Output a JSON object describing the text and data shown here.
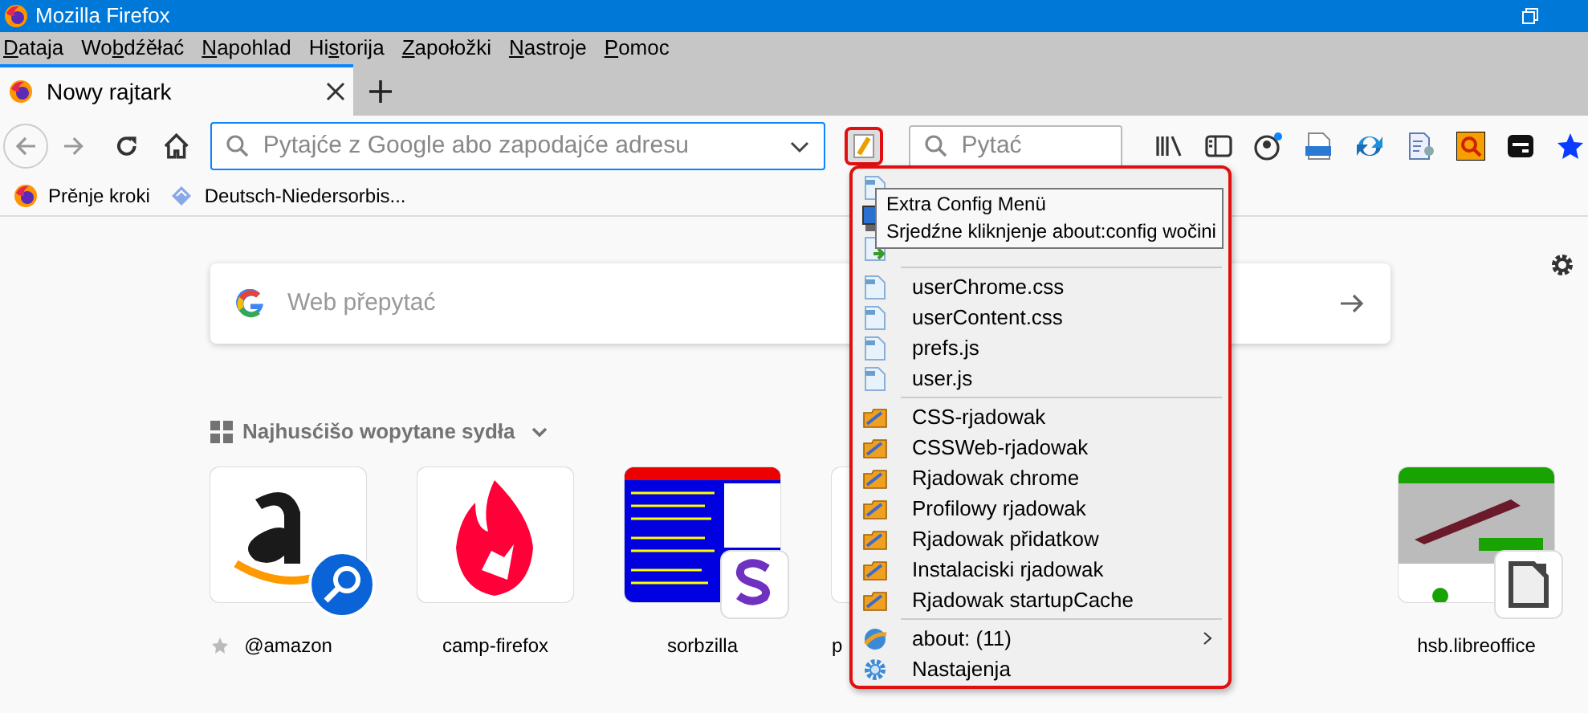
{
  "window": {
    "title": "Mozilla Firefox"
  },
  "menu_bar": [
    {
      "accel": "D",
      "after": "ataja"
    },
    {
      "before": "Wo",
      "accel": "b",
      "after": "dźěłać"
    },
    {
      "accel": "N",
      "after": "apohlad"
    },
    {
      "before": "Hi",
      "accel": "s",
      "after": "torija"
    },
    {
      "accel": "Z",
      "after": "apołožki"
    },
    {
      "accel": "N",
      "after": "astroje"
    },
    {
      "accel": "P",
      "after": "omoc"
    }
  ],
  "tabs": [
    {
      "label": "Nowy rajtark",
      "selected": true
    }
  ],
  "address_bar": {
    "placeholder": "Pytajće z Google abo zapodajće adresu"
  },
  "search_field": {
    "placeholder": "Pytać"
  },
  "bookmarks": [
    {
      "label": "Prěnje kroki",
      "kind": "firefox"
    },
    {
      "label": "Deutsch-Niedersorbis...",
      "kind": "dict"
    }
  ],
  "content": {
    "search": {
      "placeholder": "Web přepytać"
    },
    "top_sites_heading": "Najhusćišo wopytane sydła",
    "top_sites": [
      {
        "label": "@amazon",
        "kind": "amazon",
        "pinned": true
      },
      {
        "label": "camp-firefox",
        "kind": "flame",
        "pinned": false
      },
      {
        "label": "sorbzilla",
        "kind": "sorbzilla",
        "pinned": false
      },
      {
        "label": "p",
        "kind": "blank",
        "pinned": false
      },
      {
        "label": "hsb.libreoffice",
        "kind": "libreoffice",
        "pinned": false
      }
    ]
  },
  "config_menu": {
    "items": [
      {
        "kind": "file"
      },
      {
        "kind": "monitor"
      },
      {
        "kind": "list"
      },
      {
        "kind": "separator"
      },
      {
        "label": "userChrome.css",
        "kind": "file"
      },
      {
        "label": "userContent.css",
        "kind": "file"
      },
      {
        "label": "prefs.js",
        "kind": "file"
      },
      {
        "label": "user.js",
        "kind": "file"
      },
      {
        "kind": "separator"
      },
      {
        "label": "CSS-rjadowak",
        "kind": "folder"
      },
      {
        "label": "CSSWeb-rjadowak",
        "kind": "folder"
      },
      {
        "label": "Rjadowak chrome",
        "kind": "folder"
      },
      {
        "label": "Profilowy rjadowak",
        "kind": "folder"
      },
      {
        "label": "Rjadowak přidatkow",
        "kind": "folder"
      },
      {
        "label": "Instalaciski rjadowak",
        "kind": "folder"
      },
      {
        "label": "Rjadowak startupCache",
        "kind": "folder"
      },
      {
        "kind": "separator"
      },
      {
        "label": "about: (11)",
        "kind": "globe",
        "submenu": true
      },
      {
        "label": "Nastajenja",
        "kind": "gear",
        "submenu": false
      }
    ],
    "tooltip": [
      "Extra Config Menü",
      "Srjedźne kliknjenje about:config wočini"
    ]
  }
}
